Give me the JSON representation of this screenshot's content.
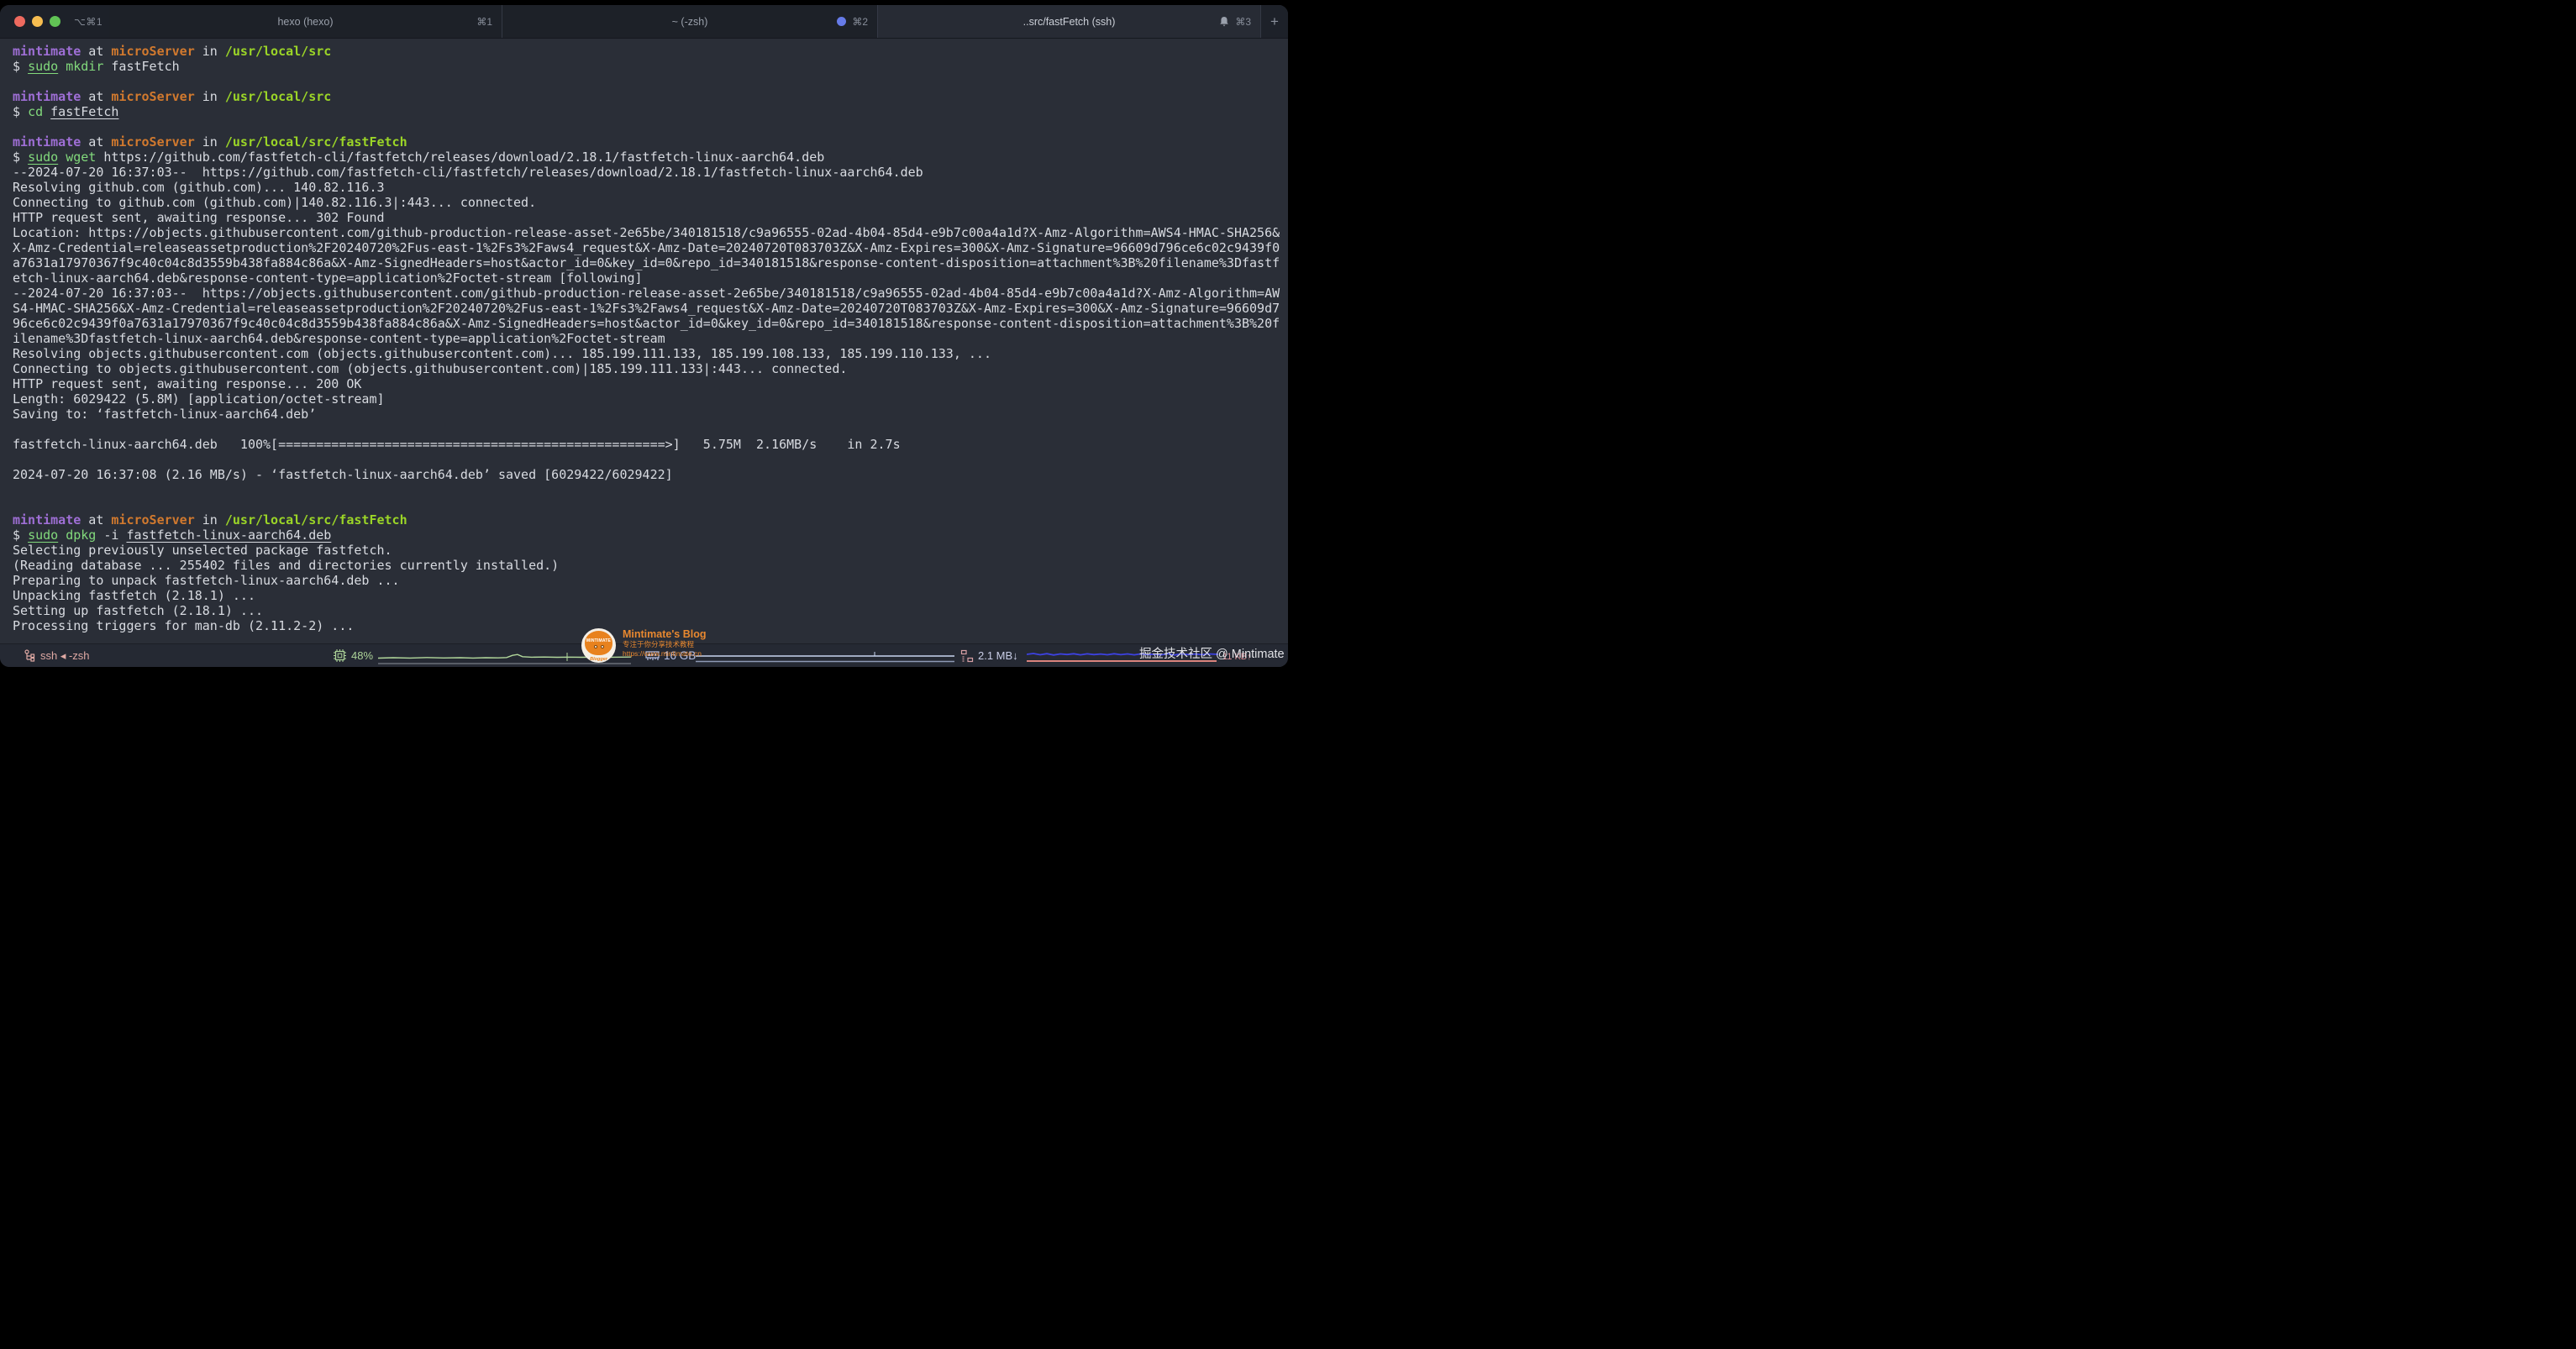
{
  "tab_bar": {
    "window_shortcut": "⌥⌘1",
    "tabs": [
      {
        "title": "hexo (hexo)",
        "shortcut": "⌘1"
      },
      {
        "title": "~ (-zsh)",
        "shortcut": "⌘2"
      },
      {
        "title": "..src/fastFetch (ssh)",
        "shortcut": "⌘3"
      }
    ],
    "new_tab_label": "+"
  },
  "terminal": {
    "lines": [
      [
        [
          "mintimate",
          "purple"
        ],
        [
          " at ",
          "fg"
        ],
        [
          "microServer",
          "orange"
        ],
        [
          " in ",
          "fg"
        ],
        [
          "/usr/local/src",
          "lime"
        ]
      ],
      [
        [
          "$ ",
          "fg"
        ],
        [
          "sudo",
          "green-u"
        ],
        [
          " ",
          "fg"
        ],
        [
          "mkdir",
          "green"
        ],
        [
          " fastFetch",
          "fg"
        ]
      ],
      [],
      [
        [
          "mintimate",
          "purple"
        ],
        [
          " at ",
          "fg"
        ],
        [
          "microServer",
          "orange"
        ],
        [
          " in ",
          "fg"
        ],
        [
          "/usr/local/src",
          "lime"
        ]
      ],
      [
        [
          "$ ",
          "fg"
        ],
        [
          "cd",
          "green"
        ],
        [
          " ",
          "fg"
        ],
        [
          "fastFetch",
          "fg-u"
        ]
      ],
      [],
      [
        [
          "mintimate",
          "purple"
        ],
        [
          " at ",
          "fg"
        ],
        [
          "microServer",
          "orange"
        ],
        [
          " in ",
          "fg"
        ],
        [
          "/usr/local/src/fastFetch",
          "lime"
        ]
      ],
      [
        [
          "$ ",
          "fg"
        ],
        [
          "sudo",
          "green-u"
        ],
        [
          " ",
          "fg"
        ],
        [
          "wget",
          "green"
        ],
        [
          " https://github.com/fastfetch-cli/fastfetch/releases/download/2.18.1/fastfetch-linux-aarch64.deb",
          "fg"
        ]
      ],
      [
        [
          "--2024-07-20 16:37:03--  https://github.com/fastfetch-cli/fastfetch/releases/download/2.18.1/fastfetch-linux-aarch64.deb",
          "fg"
        ]
      ],
      [
        [
          "Resolving github.com (github.com)... 140.82.116.3",
          "fg"
        ]
      ],
      [
        [
          "Connecting to github.com (github.com)|140.82.116.3|:443... connected.",
          "fg"
        ]
      ],
      [
        [
          "HTTP request sent, awaiting response... 302 Found",
          "fg"
        ]
      ],
      [
        [
          "Location: https://objects.githubusercontent.com/github-production-release-asset-2e65be/340181518/c9a96555-02ad-4b04-85d4-e9b7c00a4a1d?X-Amz-Algorithm=AWS4-HMAC-SHA256&",
          "fg"
        ]
      ],
      [
        [
          "X-Amz-Credential=releaseassetproduction%2F20240720%2Fus-east-1%2Fs3%2Faws4_request&X-Amz-Date=20240720T083703Z&X-Amz-Expires=300&X-Amz-Signature=96609d796ce6c02c9439f0",
          "fg"
        ]
      ],
      [
        [
          "a7631a17970367f9c40c04c8d3559b438fa884c86a&X-Amz-SignedHeaders=host&actor_id=0&key_id=0&repo_id=340181518&response-content-disposition=attachment%3B%20filename%3Dfastf",
          "fg"
        ]
      ],
      [
        [
          "etch-linux-aarch64.deb&response-content-type=application%2Foctet-stream [following]",
          "fg"
        ]
      ],
      [
        [
          "--2024-07-20 16:37:03--  https://objects.githubusercontent.com/github-production-release-asset-2e65be/340181518/c9a96555-02ad-4b04-85d4-e9b7c00a4a1d?X-Amz-Algorithm=AW",
          "fg"
        ]
      ],
      [
        [
          "S4-HMAC-SHA256&X-Amz-Credential=releaseassetproduction%2F20240720%2Fus-east-1%2Fs3%2Faws4_request&X-Amz-Date=20240720T083703Z&X-Amz-Expires=300&X-Amz-Signature=96609d7",
          "fg"
        ]
      ],
      [
        [
          "96ce6c02c9439f0a7631a17970367f9c40c04c8d3559b438fa884c86a&X-Amz-SignedHeaders=host&actor_id=0&key_id=0&repo_id=340181518&response-content-disposition=attachment%3B%20f",
          "fg"
        ]
      ],
      [
        [
          "ilename%3Dfastfetch-linux-aarch64.deb&response-content-type=application%2Foctet-stream",
          "fg"
        ]
      ],
      [
        [
          "Resolving objects.githubusercontent.com (objects.githubusercontent.com)... 185.199.111.133, 185.199.108.133, 185.199.110.133, ...",
          "fg"
        ]
      ],
      [
        [
          "Connecting to objects.githubusercontent.com (objects.githubusercontent.com)|185.199.111.133|:443... connected.",
          "fg"
        ]
      ],
      [
        [
          "HTTP request sent, awaiting response... 200 OK",
          "fg"
        ]
      ],
      [
        [
          "Length: 6029422 (5.8M) [application/octet-stream]",
          "fg"
        ]
      ],
      [
        [
          "Saving to: ‘fastfetch-linux-aarch64.deb’",
          "fg"
        ]
      ],
      [],
      [
        [
          "fastfetch-linux-aarch64.deb   100%[===================================================>]   5.75M  2.16MB/s    in 2.7s",
          "fg"
        ]
      ],
      [],
      [
        [
          "2024-07-20 16:37:08 (2.16 MB/s) - ‘fastfetch-linux-aarch64.deb’ saved [6029422/6029422]",
          "fg"
        ]
      ],
      [],
      [],
      [
        [
          "mintimate",
          "purple"
        ],
        [
          " at ",
          "fg"
        ],
        [
          "microServer",
          "orange"
        ],
        [
          " in ",
          "fg"
        ],
        [
          "/usr/local/src/fastFetch",
          "lime"
        ]
      ],
      [
        [
          "$ ",
          "fg"
        ],
        [
          "sudo",
          "green-u"
        ],
        [
          " ",
          "fg"
        ],
        [
          "dpkg",
          "green"
        ],
        [
          " -i ",
          "fg"
        ],
        [
          "fastfetch-linux-aarch64.deb",
          "fg-u"
        ]
      ],
      [
        [
          "Selecting previously unselected package fastfetch.",
          "fg"
        ]
      ],
      [
        [
          "(Reading database ... 255402 files and directories currently installed.)",
          "fg"
        ]
      ],
      [
        [
          "Preparing to unpack fastfetch-linux-aarch64.deb ...",
          "fg"
        ]
      ],
      [
        [
          "Unpacking fastfetch (2.18.1) ...",
          "fg"
        ]
      ],
      [
        [
          "Setting up fastfetch (2.18.1) ...",
          "fg"
        ]
      ],
      [
        [
          "Processing triggers for man-db (2.11.2-2) ...",
          "fg"
        ]
      ]
    ]
  },
  "status_bar": {
    "session": "ssh ◂ -zsh",
    "cpu_percent": "48%",
    "memory": "16 GB",
    "net_down": "2.1 MB↓",
    "net_up": "11 KB↑"
  },
  "watermark": {
    "logo_name": "MINTIMATE",
    "logo_role": "Blogger",
    "title": "Mintimate's Blog",
    "subtitle": "专注于你分享技术教程",
    "url": "https://www.mintimate.cn",
    "right_text": "掘金技术社区 @ Mintimate"
  },
  "colors": {
    "terminal_bg": "#2a2e37",
    "tabbar_bg": "#1d2129",
    "prompt_user": "#9f6fd6",
    "prompt_host": "#d1792e",
    "prompt_path": "#9bd527",
    "command_green": "#82d97c",
    "statusbar_cpu": "#aed59a",
    "statusbar_mem": "#b7c1e6",
    "statusbar_net_down_line": "#3d42e3",
    "statusbar_net_up": "#d98f96",
    "activity_dot": "#667be8",
    "watermark_orange": "#e8882f"
  }
}
